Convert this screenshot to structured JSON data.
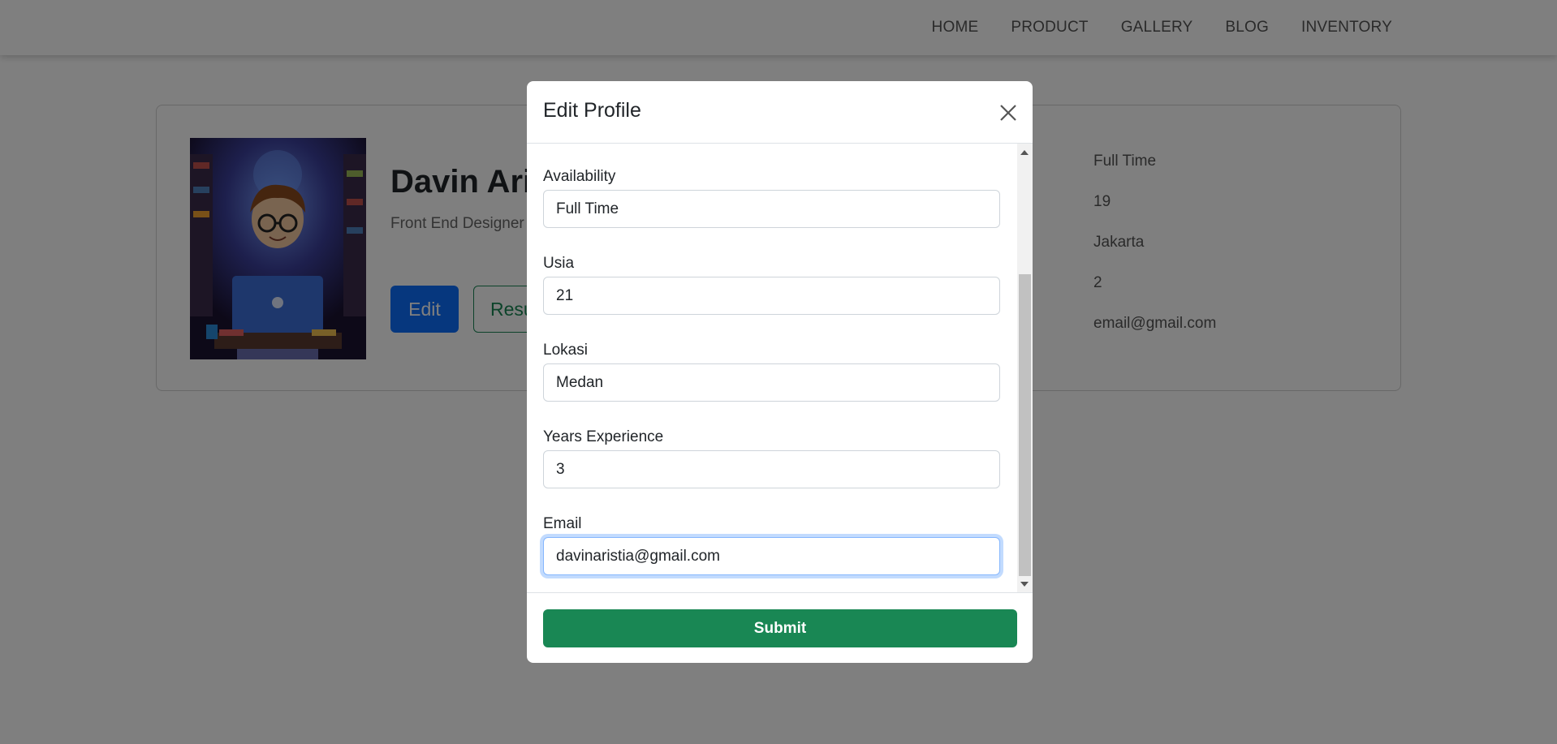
{
  "nav": {
    "items": [
      {
        "label": "HOME"
      },
      {
        "label": "PRODUCT"
      },
      {
        "label": "GALLERY"
      },
      {
        "label": "BLOG"
      },
      {
        "label": "INVENTORY"
      }
    ]
  },
  "profile": {
    "name": "Davin Ari",
    "role": "Front End Designer",
    "edit_label": "Edit",
    "resume_label": "Resu",
    "info": [
      "Full Time",
      "19",
      "Jakarta",
      "2",
      "email@gmail.com"
    ]
  },
  "modal": {
    "title": "Edit Profile",
    "fields": [
      {
        "label": "Availability",
        "value": "Full Time"
      },
      {
        "label": "Usia",
        "value": "21"
      },
      {
        "label": "Lokasi",
        "value": "Medan"
      },
      {
        "label": "Years Experience",
        "value": "3"
      },
      {
        "label": "Email",
        "value": "davinaristia@gmail.com"
      }
    ],
    "submit_label": "Submit"
  },
  "colors": {
    "primary": "#0d6efd",
    "success": "#198754",
    "backdrop": "rgba(0,0,0,0.5)"
  }
}
